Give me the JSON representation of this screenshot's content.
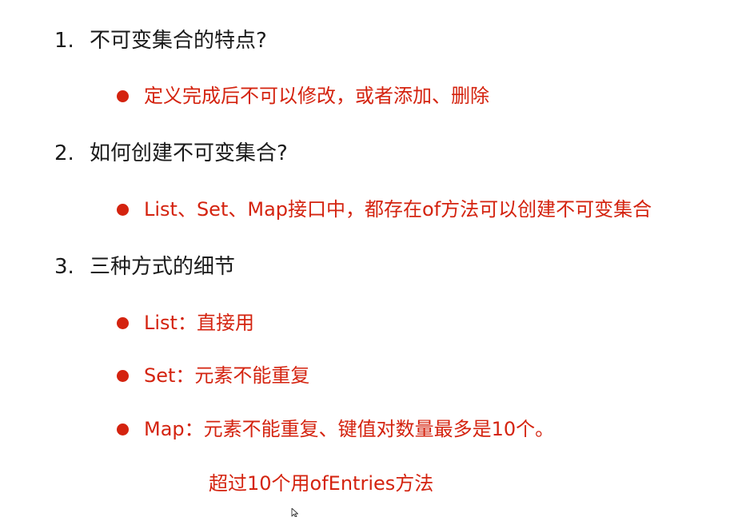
{
  "items": [
    {
      "number": "1.",
      "question": "不可变集合的特点?",
      "bullets": [
        "定义完成后不可以修改，或者添加、删除"
      ]
    },
    {
      "number": "2.",
      "question": "如何创建不可变集合?",
      "bullets": [
        "List、Set、Map接口中，都存在of方法可以创建不可变集合"
      ]
    },
    {
      "number": "3.",
      "question": "三种方式的细节",
      "bullets": [
        "List：直接用",
        "Set：元素不能重复",
        "Map：元素不能重复、键值对数量最多是10个。"
      ],
      "continuation": "超过10个用ofEntries方法"
    }
  ],
  "colors": {
    "heading": "#1a1a1a",
    "bullet": "#d4230f",
    "background": "#ffffff"
  },
  "icons": {
    "bullet": "filled-circle",
    "cursor": "mouse-pointer-icon"
  }
}
